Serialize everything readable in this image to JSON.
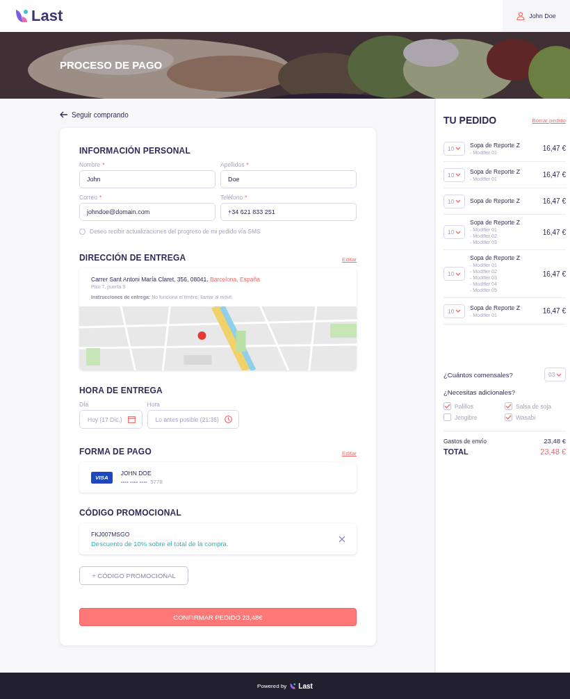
{
  "header": {
    "logo": "Last",
    "user": "John Doe"
  },
  "hero": {
    "title": "PROCESO DE PAGO",
    "kind": "picture"
  },
  "back_link": "Seguir comprando",
  "personal": {
    "title": "INFORMACIÓN PERSONAL",
    "fields": [
      {
        "label": "Nombre",
        "required_mark": "*",
        "value": "John"
      },
      {
        "label": "Apellidos",
        "required_mark": "*",
        "value": "Doe"
      },
      {
        "label": "Correo",
        "required_mark": "*",
        "value": "johndoe@domain.com"
      },
      {
        "label": "Teléfono",
        "required_mark": "*",
        "value": "+34 621 833 251"
      }
    ],
    "sms": {
      "label": "Deseo recibir actualizaciones del progreso de mi pedido vía SMS",
      "checked": false
    }
  },
  "address": {
    "title": "DIRECCIÓN DE ENTREGA",
    "edit": "Editar",
    "street": "Carrer Sant Antoni María Claret, 356, 08041.",
    "city": "Barcelona, España",
    "detail": "Piso 7, puerta 3",
    "instructions_label": "Instrucciones de entrega:",
    "instructions": "No funciona el timbre, llamar al móvil."
  },
  "delivery_time": {
    "title": "HORA DE ENTREGA",
    "day_label": "Día",
    "day": "Hoy (17 Dic.)",
    "hour_label": "Hora",
    "hour": "Lo antes posible (21:35)"
  },
  "payment": {
    "title": "FORMA DE PAGO",
    "edit": "Editar",
    "brand": "VISA",
    "holder": "JOHN DOE",
    "masked": "•••• •••• ••••",
    "last4": "5778"
  },
  "promo": {
    "title": "CÓDIGO PROMOCIONAL",
    "code": "FKJ007MSGO",
    "description": "Descuento de 10% sobre el total de la compra.",
    "add_button": "+ CÓDIGO PROMOCIONAL"
  },
  "confirm_button": "CONFIRMAR PEDIDO 23,48€",
  "order": {
    "title": "TU PEDIDO",
    "clear": "Borrar pedido",
    "items": [
      {
        "qty": "10",
        "name": "Sopa de Reporte Z",
        "modifiers": [
          "- Modifier 01"
        ],
        "price": "16,47 €"
      },
      {
        "qty": "10",
        "name": "Sopa de Reporte Z",
        "modifiers": [
          "- Modifier 01"
        ],
        "price": "16,47 €"
      },
      {
        "qty": "10",
        "name": "Sopa de Reporte Z",
        "price": "16,47 €"
      },
      {
        "qty": "10",
        "name": "Sopa de Reporte Z",
        "modifiers": [
          "- Modifier 01",
          "- Modifier 02",
          "- Modifier 03"
        ],
        "price": "16,47 €"
      },
      {
        "qty": "10",
        "name": "Sopa de Reporte Z",
        "modifiers": [
          "- Modifier 01",
          "- Modifier 02",
          "- Modifier 03",
          "- Modifier 04",
          "- Modifier 05"
        ],
        "price": "16,47 €"
      },
      {
        "qty": "10",
        "name": "Sopa de Reporte Z",
        "modifiers": [
          "- Modifier 01"
        ],
        "price": "16,47 €"
      }
    ],
    "diners_label": "¿Cuántos comensales?",
    "diners": "03",
    "extras_label": "¿Necesitas adicionales?",
    "extras": [
      {
        "label": "Palillos",
        "checked": true
      },
      {
        "label": "Salsa de soja",
        "checked": true
      },
      {
        "label": "Jengibre",
        "checked": false
      },
      {
        "label": "Wasabi",
        "checked": true
      }
    ],
    "shipping_label": "Gastos de envío",
    "shipping": "23,48 €",
    "total_label": "TOTAL",
    "total": "23,48 €"
  },
  "footer": {
    "powered": "Powered by",
    "logo": "Last"
  }
}
